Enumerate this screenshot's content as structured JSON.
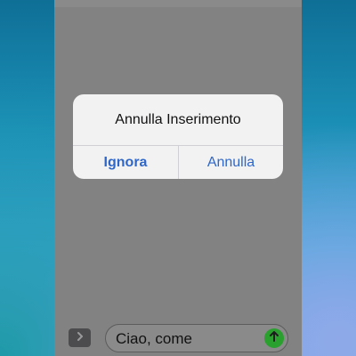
{
  "alert": {
    "title": "Annulla Inserimento",
    "buttons": {
      "ignore": "Ignora",
      "cancel": "Annulla"
    }
  },
  "composer": {
    "input_value": "Ciao, come",
    "expand_icon": "chevron-right-icon",
    "send_icon": "arrow-up-icon"
  },
  "colors": {
    "accent": "#2f67c9",
    "send_button": "#2aa02f"
  }
}
